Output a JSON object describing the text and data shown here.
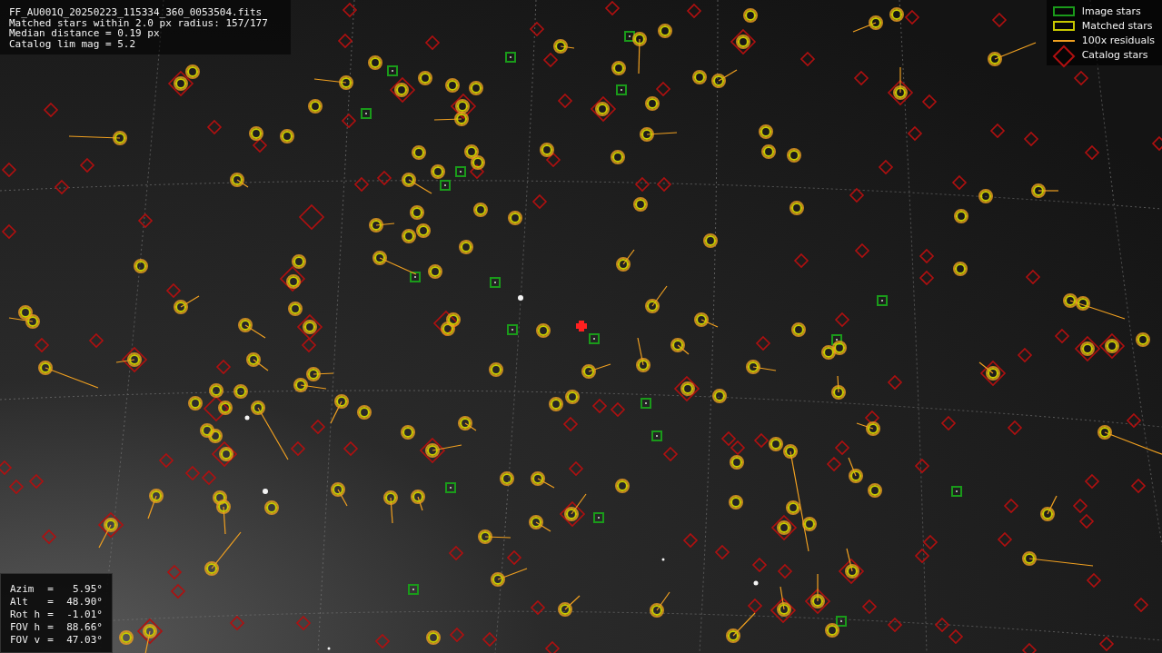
{
  "header": {
    "lines": [
      "FF_AU001Q_20250223_115334_360_0053504.fits",
      "Matched stars within 2.0 px radius: 157/177",
      "Median distance = 0.19 px",
      "Catalog lim mag = 5.2"
    ]
  },
  "legend": [
    {
      "kind": "image",
      "label": "Image stars",
      "color": "#1a9a1a"
    },
    {
      "kind": "matched",
      "label": "Matched stars",
      "color": "#c8c800"
    },
    {
      "kind": "residual",
      "label": "100x residuals",
      "color": "#f0a020"
    },
    {
      "kind": "catalog",
      "label": "Catalog stars",
      "color": "#b01010"
    }
  ],
  "pointing": [
    {
      "label": "Azim",
      "sep": "=",
      "value": "5.95°"
    },
    {
      "label": "Alt",
      "sep": "=",
      "value": "48.90°"
    },
    {
      "label": "Rot h",
      "sep": "=",
      "value": "-1.01°"
    },
    {
      "label": "FOV h",
      "sep": "=",
      "value": "88.66°"
    },
    {
      "label": "FOV v",
      "sep": "=",
      "value": "47.03°"
    }
  ]
}
